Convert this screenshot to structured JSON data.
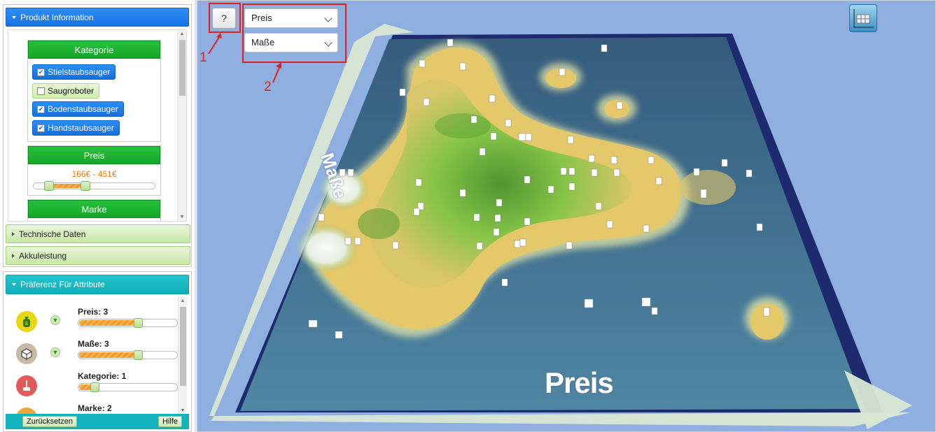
{
  "sidebar": {
    "product_panel": {
      "title": "Produkt Information",
      "kategorie": {
        "title": "Kategorie",
        "items": [
          {
            "label": "Stielstaubsauger",
            "checked": true
          },
          {
            "label": "Saugroboter",
            "checked": false
          },
          {
            "label": "Bodenstaubsauger",
            "checked": true
          },
          {
            "label": "Handstaubsauger",
            "checked": true
          }
        ]
      },
      "preis": {
        "title": "Preis",
        "range_text": "166€ - 451€"
      },
      "marke": {
        "title": "Marke"
      },
      "accordions": [
        "Technische Daten",
        "Akkuleistung"
      ]
    },
    "preference_panel": {
      "title": "Präferenz Für Attribute",
      "items": [
        {
          "label": "Preis: 3",
          "value": 3,
          "icon": "money-bag-icon",
          "color": "#e8d712"
        },
        {
          "label": "Maße: 3",
          "value": 3,
          "icon": "cube-icon",
          "color": "#c9b9a5"
        },
        {
          "label": "Kategorie: 1",
          "value": 1,
          "icon": "vacuum-icon",
          "color": "#e35a5a"
        },
        {
          "label": "Marke: 2",
          "value": 2,
          "icon": "brand-icon",
          "color": "#f0a43a"
        }
      ],
      "reset_label": "Zurücksetzen",
      "help_label": "Hilfe"
    }
  },
  "map": {
    "help_button_label": "?",
    "x_axis_select": "Preis",
    "y_axis_select": "Maße",
    "x_axis_label": "Preis",
    "y_axis_label": "Maße",
    "annotation_1": "1",
    "annotation_2": "2",
    "colors": {
      "sea": "#8fb0dd",
      "land": "#e6c76a",
      "hill": "#59b83a",
      "snow": "#f2f4f0"
    }
  }
}
